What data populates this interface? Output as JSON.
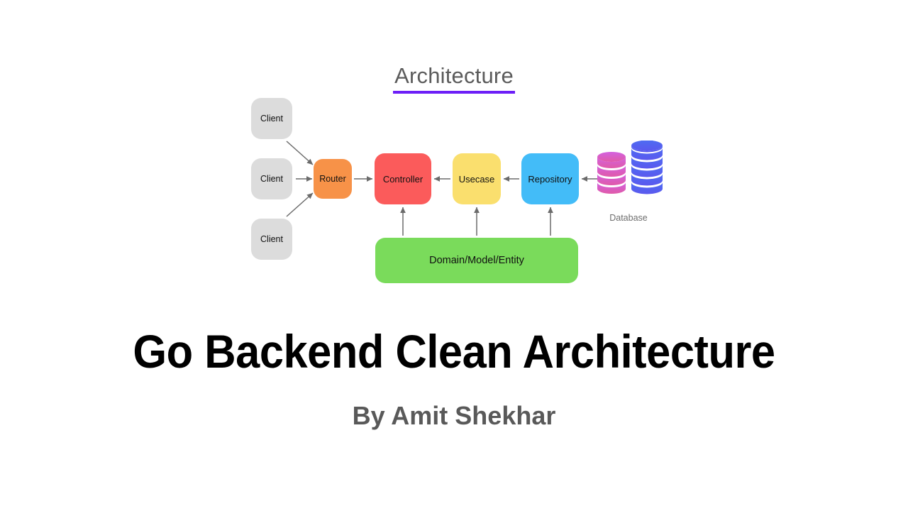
{
  "slide": {
    "background_color": "#ffffff",
    "main_title": "Go Backend Clean Architecture",
    "author_subtitle": "By Amit Shekhar"
  },
  "diagram": {
    "title": "Architecture",
    "title_underline_color": "#6d1ff7",
    "title_color": "#5b5b5b",
    "nodes": [
      {
        "id": "client-1",
        "label": "Client",
        "color": "#dcdcdc"
      },
      {
        "id": "client-2",
        "label": "Client",
        "color": "#dcdcdc"
      },
      {
        "id": "client-3",
        "label": "Client",
        "color": "#dcdcdc"
      },
      {
        "id": "router",
        "label": "Router",
        "color": "#f79248"
      },
      {
        "id": "controller",
        "label": "Controller",
        "color": "#fb5b5b"
      },
      {
        "id": "usecase",
        "label": "Usecase",
        "color": "#fadf6e"
      },
      {
        "id": "repository",
        "label": "Repository",
        "color": "#43bcf8"
      },
      {
        "id": "domain",
        "label": "Domain/Model/Entity",
        "color": "#7adb5b"
      }
    ],
    "database": {
      "label": "Database",
      "label_color": "#6d6d6d",
      "stack_left_color": "#d255d2",
      "stack_right_color": "#4a5ff0"
    },
    "arrow_color": "#6b6b6b",
    "edges": [
      {
        "from": "client-1",
        "to": "router",
        "direction": "down-right"
      },
      {
        "from": "client-2",
        "to": "router",
        "direction": "right"
      },
      {
        "from": "client-3",
        "to": "router",
        "direction": "up-right"
      },
      {
        "from": "router",
        "to": "controller",
        "direction": "right"
      },
      {
        "from": "usecase",
        "to": "controller",
        "direction": "left"
      },
      {
        "from": "repository",
        "to": "usecase",
        "direction": "left"
      },
      {
        "from": "database",
        "to": "repository",
        "direction": "left"
      },
      {
        "from": "domain",
        "to": "controller",
        "direction": "up"
      },
      {
        "from": "domain",
        "to": "usecase",
        "direction": "up"
      },
      {
        "from": "domain",
        "to": "repository",
        "direction": "up"
      }
    ]
  }
}
